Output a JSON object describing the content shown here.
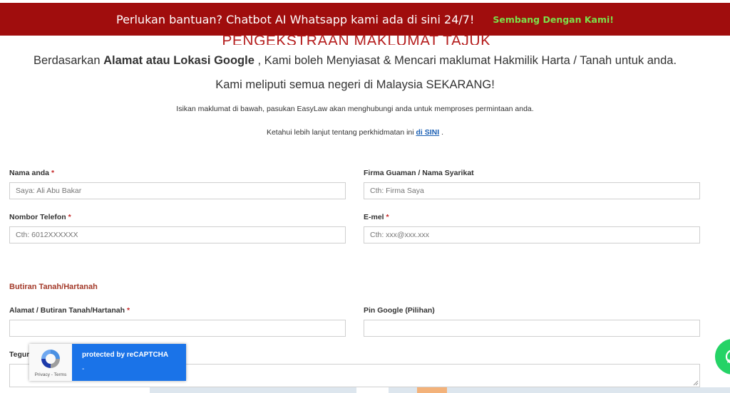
{
  "banner": {
    "text": "Perlukan bantuan? Chatbot AI Whatsapp kami ada di sini 24/7!",
    "link": "Sembang Dengan Kami!"
  },
  "page": {
    "title": "PENGEKSTRAAN MAKLUMAT TAJUK",
    "intro_line1_prefix": "Berdasarkan ",
    "intro_line1_bold": "Alamat atau Lokasi Google",
    "intro_line1_suffix": " , Kami boleh Menyiasat & Mencari maklumat Hakmilik Harta / Tanah untuk anda.",
    "intro_line2": "Kami meliputi semua negeri di Malaysia SEKARANG!",
    "intro_line3": "Isikan maklumat di bawah, pasukan EasyLaw akan menghubungi anda untuk memproses permintaan anda.",
    "intro_line4_prefix": "Ketahui lebih lanjut tentang perkhidmatan ini ",
    "intro_line4_link": "di SINI",
    "intro_line4_suffix": " ."
  },
  "form": {
    "name": {
      "label": "Nama anda",
      "required": "*",
      "placeholder": "Saya: Ali Abu Bakar"
    },
    "firm": {
      "label": "Firma Guaman / Nama Syarikat",
      "placeholder": "Cth: Firma Saya"
    },
    "phone": {
      "label": "Nombor Telefon",
      "required": "*",
      "placeholder": "Cth: 6012XXXXXX"
    },
    "email": {
      "label": "E-mel",
      "required": "*",
      "placeholder": "Cth: xxx@xxx.xxx"
    },
    "section_title": "Butiran Tanah/Hartanah",
    "address": {
      "label": "Alamat / Butiran Tanah/Hartanah",
      "required": "*",
      "value": ""
    },
    "pin": {
      "label": "Pin Google (Pilihan)",
      "value": ""
    },
    "remark": {
      "label": "Teguran",
      "value": ""
    }
  },
  "recaptcha": {
    "text": "protected by reCAPTCHA",
    "dash": "-",
    "links": "Privacy - Terms"
  },
  "colors": {
    "banner_bg": "#a00d0d",
    "banner_link": "#7be04a",
    "title_red": "#b51d1d",
    "section_red": "#a33a2a",
    "recaptcha_blue": "#1a73e8",
    "whatsapp_green": "#25d366"
  },
  "icons": [
    "recaptcha-logo-icon",
    "whatsapp-icon"
  ]
}
